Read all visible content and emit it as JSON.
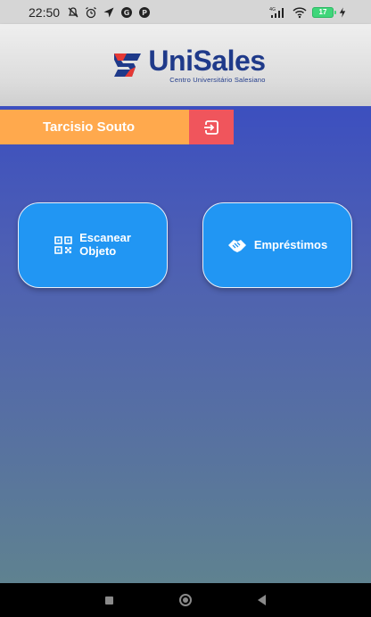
{
  "status_bar": {
    "time": "22:50",
    "battery_level": "17",
    "icons": [
      "notification-muted-icon",
      "alarm-icon",
      "location-icon",
      "app-notification-icon",
      "app-notification-icon",
      "signal-4g-icon",
      "wifi-icon",
      "battery-charging-icon"
    ]
  },
  "header": {
    "brand_name": "UniSales",
    "brand_subtitle": "Centro Universitário Salesiano",
    "colors": {
      "brand_blue": "#1f3a8a",
      "brand_red": "#e53935"
    }
  },
  "user_bar": {
    "name": "Tarcisio Souto",
    "logout_icon": "logout-icon",
    "colors": {
      "name_bg": "#ffa94d",
      "logout_bg": "#f0555c"
    }
  },
  "actions": {
    "scan": {
      "label_line1": "Escanear",
      "label_line2": "Objeto",
      "icon": "qr-code-icon"
    },
    "loans": {
      "label": "Empréstimos",
      "icon": "handshake-icon"
    },
    "colors": {
      "button_bg": "#2196f3"
    }
  },
  "nav_bar": {
    "items": [
      "recents-button",
      "home-button",
      "back-button"
    ]
  }
}
